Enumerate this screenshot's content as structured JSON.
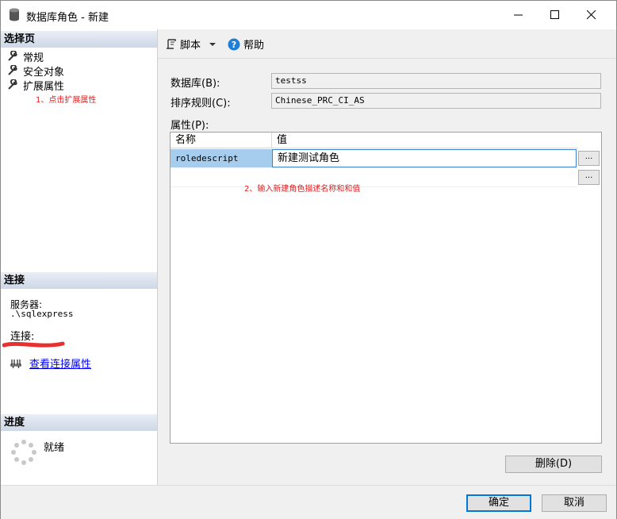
{
  "window": {
    "title": "数据库角色 - 新建",
    "controls": {
      "minimize": "—",
      "maximize": "☐",
      "close": "✕"
    }
  },
  "left_pane": {
    "select_page": {
      "header": "选择页",
      "items": [
        {
          "label": "常规",
          "icon": "wrench-icon"
        },
        {
          "label": "安全对象",
          "icon": "wrench-icon"
        },
        {
          "label": "扩展属性",
          "icon": "wrench-icon"
        }
      ],
      "annotation": "1、点击扩展属性"
    },
    "connection": {
      "header": "连接",
      "server_label": "服务器:",
      "server_value": ".\\sqlexpress",
      "connection_label": "连接:",
      "link_label": "查看连接属性"
    },
    "progress": {
      "header": "进度",
      "status": "就绪"
    }
  },
  "toolbar": {
    "script_label": "脚本",
    "help_label": "帮助"
  },
  "form": {
    "database_label": "数据库(B):",
    "database_value": "testss",
    "collation_label": "排序规则(C):",
    "collation_value": "Chinese_PRC_CI_AS",
    "properties_label": "属性(P):"
  },
  "grid": {
    "headers": [
      "名称",
      "值"
    ],
    "rows": [
      {
        "name": "roledescript",
        "value": "新建测试角色"
      }
    ],
    "ellipsis": "...",
    "annotation": "2、输入新建角色描述名称和和值"
  },
  "buttons": {
    "delete": "删除(D)",
    "ok": "确定",
    "cancel": "取消"
  },
  "colors": {
    "annotation": "#e02020",
    "link": "#0000ee",
    "selected_cell": "#a7cdee",
    "focus_border": "#0078d7"
  }
}
